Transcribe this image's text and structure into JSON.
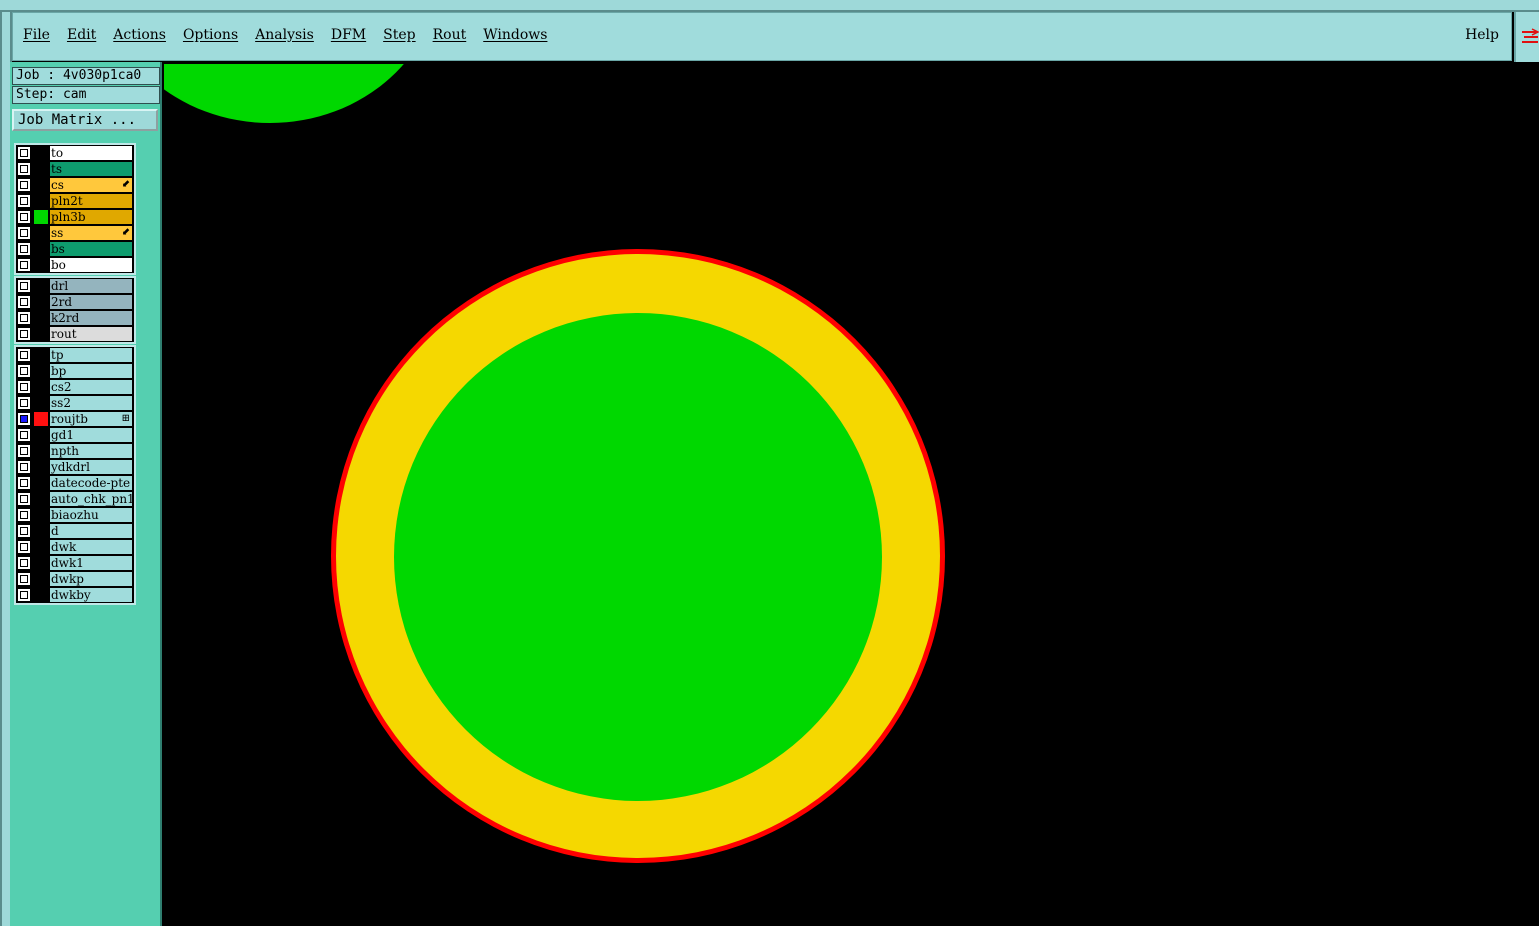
{
  "menu": {
    "items": [
      "File",
      "Edit",
      "Actions",
      "Options",
      "Analysis",
      "DFM",
      "Step",
      "Rout",
      "Windows"
    ],
    "help": "Help"
  },
  "job": {
    "job_label": "Job : 4v030p1ca0",
    "step_label": "Step: cam",
    "matrix_button": "Job Matrix ..."
  },
  "layers": {
    "board": [
      {
        "name": "to",
        "bg": "#ffffff",
        "fg": "#000",
        "swatch": "#000000"
      },
      {
        "name": "ts",
        "bg": "#0e9c6e",
        "fg": "#000",
        "swatch": "#000000"
      },
      {
        "name": "cs",
        "bg": "#ffc83c",
        "fg": "#000",
        "swatch": "#000000",
        "mark": "⬋"
      },
      {
        "name": "pln2t",
        "bg": "#e0a800",
        "fg": "#000",
        "swatch": "#000000"
      },
      {
        "name": "pln3b",
        "bg": "#e0a800",
        "fg": "#000",
        "swatch": "#00d800"
      },
      {
        "name": "ss",
        "bg": "#ffc83c",
        "fg": "#000",
        "swatch": "#000000",
        "mark": "⬋"
      },
      {
        "name": "bs",
        "bg": "#0e9c6e",
        "fg": "#000",
        "swatch": "#000000"
      },
      {
        "name": "bo",
        "bg": "#ffffff",
        "fg": "#000",
        "swatch": "#000000"
      }
    ],
    "drill": [
      {
        "name": "drl",
        "bg": "#94b4be",
        "fg": "#000",
        "swatch": "#000000"
      },
      {
        "name": "2rd",
        "bg": "#94b4be",
        "fg": "#000",
        "swatch": "#000000"
      },
      {
        "name": "k2rd",
        "bg": "#94b4be",
        "fg": "#000",
        "swatch": "#000000"
      },
      {
        "name": "rout",
        "bg": "#dcdcdc",
        "fg": "#000",
        "swatch": "#000000"
      }
    ],
    "misc": [
      {
        "name": "tp",
        "bg": "#a0dcdc",
        "fg": "#000",
        "swatch": "#000000"
      },
      {
        "name": "bp",
        "bg": "#a0dcdc",
        "fg": "#000",
        "swatch": "#000000"
      },
      {
        "name": "cs2",
        "bg": "#a0dcdc",
        "fg": "#000",
        "swatch": "#000000"
      },
      {
        "name": "ss2",
        "bg": "#a0dcdc",
        "fg": "#000",
        "swatch": "#000000"
      },
      {
        "name": "roujtb",
        "bg": "#a0dcdc",
        "fg": "#000",
        "swatch": "#ff1010",
        "checked": true,
        "mark": "⊞"
      },
      {
        "name": "gd1",
        "bg": "#a0dcdc",
        "fg": "#000",
        "swatch": "#000000"
      },
      {
        "name": "npth",
        "bg": "#a0dcdc",
        "fg": "#000",
        "swatch": "#000000"
      },
      {
        "name": "ydkdrl",
        "bg": "#a0dcdc",
        "fg": "#000",
        "swatch": "#000000"
      },
      {
        "name": "datecode-pte",
        "bg": "#a0dcdc",
        "fg": "#000",
        "swatch": "#000000"
      },
      {
        "name": "auto_chk_pn1",
        "bg": "#a0dcdc",
        "fg": "#000",
        "swatch": "#000000"
      },
      {
        "name": "biaozhu",
        "bg": "#a0dcdc",
        "fg": "#000",
        "swatch": "#000000"
      },
      {
        "name": "d",
        "bg": "#a0dcdc",
        "fg": "#000",
        "swatch": "#000000"
      },
      {
        "name": "dwk",
        "bg": "#a0dcdc",
        "fg": "#000",
        "swatch": "#000000"
      },
      {
        "name": "dwk1",
        "bg": "#a0dcdc",
        "fg": "#000",
        "swatch": "#000000"
      },
      {
        "name": "dwkp",
        "bg": "#a0dcdc",
        "fg": "#000",
        "swatch": "#000000"
      },
      {
        "name": "dwkby",
        "bg": "#a0dcdc",
        "fg": "#000",
        "swatch": "#000000"
      }
    ]
  },
  "colors": {
    "pad_outline": "#ff0000",
    "pad_ring": "#f5d800",
    "pad_fill": "#00d800",
    "canvas_bg": "#000000"
  }
}
